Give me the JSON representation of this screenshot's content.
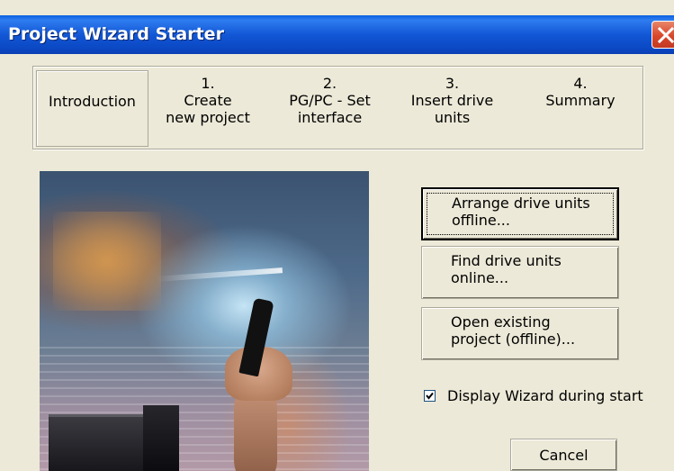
{
  "window": {
    "title": "Project Wizard Starter"
  },
  "steps": [
    {
      "number": "",
      "label": "Introduction",
      "active": true
    },
    {
      "number": "1.",
      "label": "Create\nnew project"
    },
    {
      "number": "2.",
      "label": "PG/PC - Set\ninterface"
    },
    {
      "number": "3.",
      "label": "Insert drive\nunits"
    },
    {
      "number": "4.",
      "label": "Summary"
    }
  ],
  "actions": {
    "arrange_offline": "Arrange drive units\noffline...",
    "find_online": "Find drive units\nonline...",
    "open_existing": "Open existing\nproject (offline)..."
  },
  "options": {
    "display_wizard_label": "Display Wizard during start",
    "display_wizard_checked": true
  },
  "footer": {
    "cancel_label": "Cancel"
  },
  "colors": {
    "title_bar": "#0b48c4",
    "close_button": "#d9472b",
    "dialog_bg": "#ece9d8"
  }
}
